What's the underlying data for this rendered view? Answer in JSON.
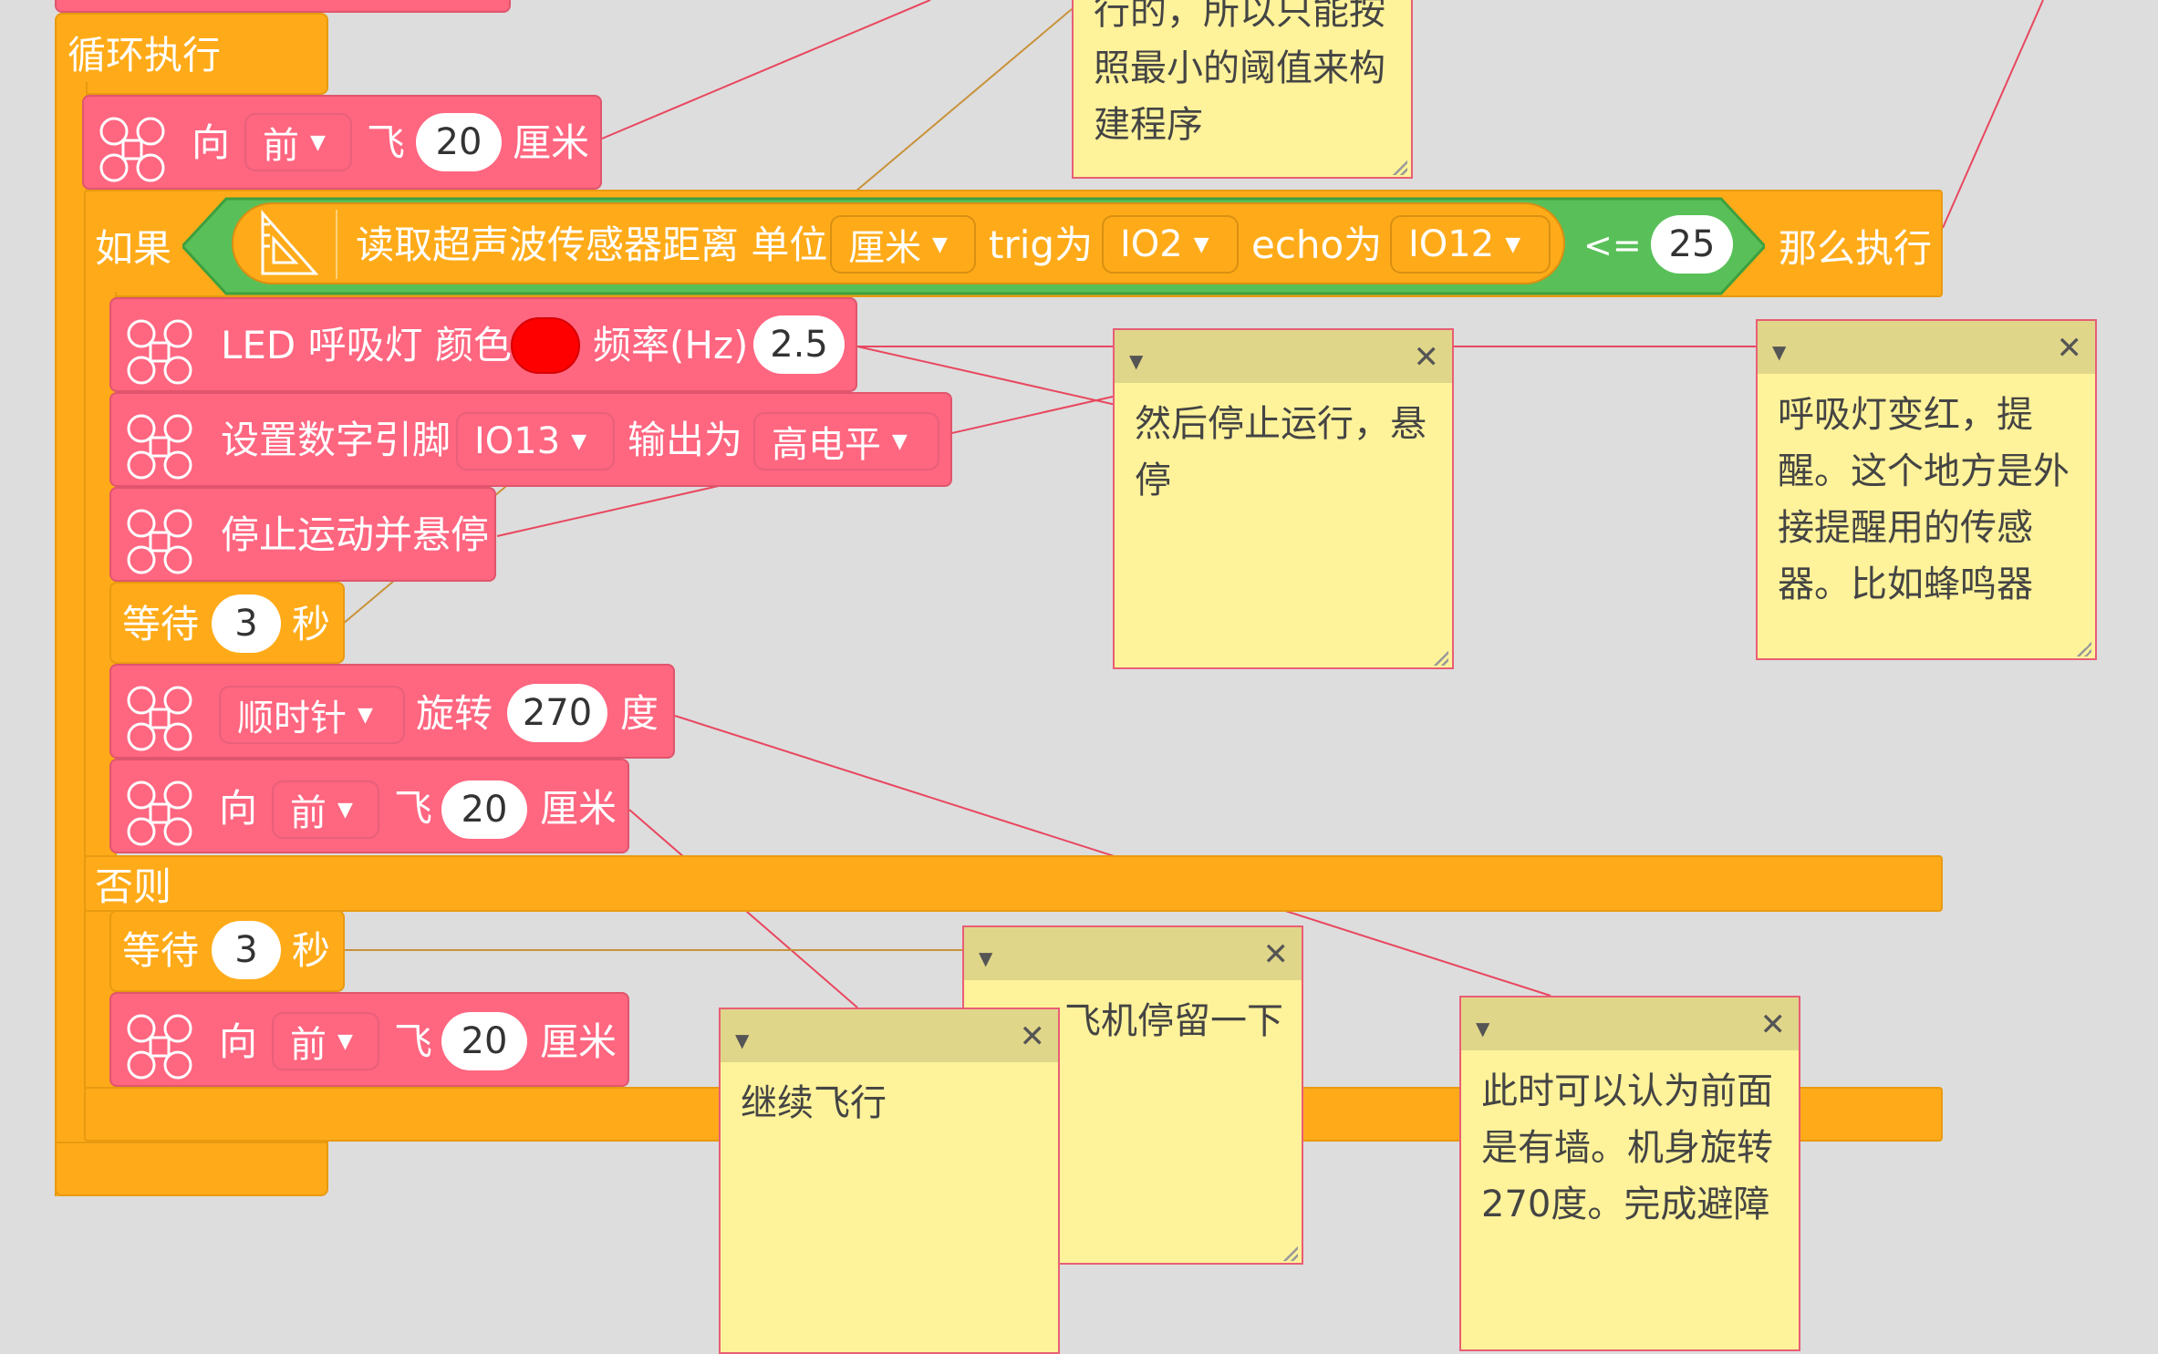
{
  "colors": {
    "motion": "#ff6680",
    "control": "#ffab19",
    "logic": "#59c059",
    "note": "#fef29a",
    "led": "#ff0000"
  },
  "loop": {
    "label": "循环执行"
  },
  "fly1": {
    "dir_prefix": "向",
    "dir": "前",
    "verb": "飞",
    "dist": "20",
    "unit": "厘米"
  },
  "if_block": {
    "if_label": "如果",
    "sensor_text": "读取超声波传感器距离 单位",
    "unit": "厘米",
    "trig_label": "trig为",
    "trig": "IO2",
    "echo_label": "echo为",
    "echo": "IO12",
    "op": "<=",
    "threshold": "25",
    "then_label": "那么执行",
    "else_label": "否则"
  },
  "led": {
    "label1": "LED 呼吸灯 颜色",
    "label2": "频率(Hz)",
    "freq": "2.5"
  },
  "pin": {
    "label1": "设置数字引脚",
    "pin": "IO13",
    "label2": "输出为",
    "level": "高电平"
  },
  "hover": {
    "label": "停止运动并悬停"
  },
  "wait1": {
    "label": "等待",
    "value": "3",
    "unit": "秒"
  },
  "rotate": {
    "dir": "顺时针",
    "label": "旋转",
    "value": "270",
    "unit": "度"
  },
  "fly2": {
    "dir_prefix": "向",
    "dir": "前",
    "verb": "飞",
    "dist": "20",
    "unit": "厘米"
  },
  "wait2": {
    "label": "等待",
    "value": "3",
    "unit": "秒"
  },
  "fly3": {
    "dir_prefix": "向",
    "dir": "前",
    "verb": "飞",
    "dist": "20",
    "unit": "厘米"
  },
  "notes": {
    "top": "行的，所以只能按\n照最小的阈值来构\n建程序",
    "stop": "然后停止运行，悬\n停",
    "breath": "呼吸灯变红，提\n醒。这个地方是外\n接提醒用的传感\n器。比如蜂鸣器",
    "stay": "飞机停留一下",
    "continue": "继续飞行",
    "wall": "此时可以认为前面\n是有墙。机身旋转\n270度。完成避障"
  }
}
